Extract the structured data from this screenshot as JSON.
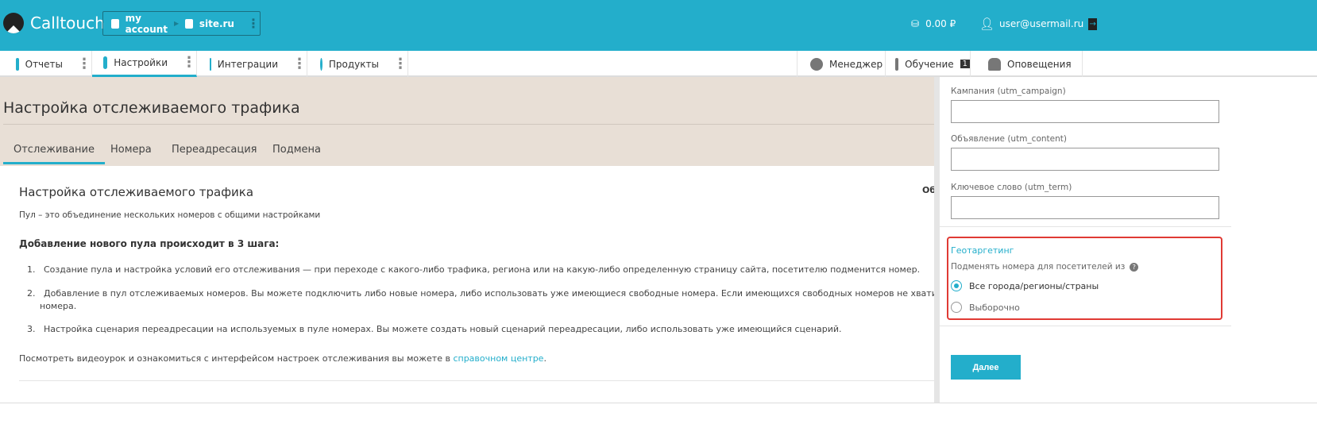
{
  "header": {
    "brand": "Calltouch",
    "account": "my account",
    "site": "site.ru",
    "balance": "0.00 ₽",
    "user": "user@usermail.ru"
  },
  "nav": {
    "left": [
      {
        "label": "Отчеты"
      },
      {
        "label": "Настройки",
        "active": true
      },
      {
        "label": "Интеграции"
      },
      {
        "label": "Продукты"
      }
    ],
    "right": [
      {
        "label": "Менеджер"
      },
      {
        "label": "Обучение",
        "badge": "1"
      },
      {
        "label": "Оповещения"
      }
    ]
  },
  "page": {
    "title": "Настройка отслеживаемого трафика",
    "tabs": [
      "Отслеживание",
      "Номера",
      "Переадресация",
      "Подмена"
    ],
    "active_tab": "Отслеживание"
  },
  "content": {
    "heading": "Настройка отслеживаемого трафика",
    "side_label": "Общ",
    "intro": "Пул – это объединение нескольких номеров с общими настройками",
    "steps_title": "Добавление нового пула происходит в 3 шага:",
    "steps": [
      "Создание пула и настройка условий его отслеживания — при переходе с какого-либо трафика, региона или на какую-либо определенную страницу сайта, посетителю подменится номер.",
      "Добавление в пул отслеживаемых номеров. Вы можете подключить либо новые номера, либо использовать уже имеющиеся свободные номера. Если имеющихся свободных номеров не хватит, можно",
      "номера.",
      "Настройка сценария переадресации на используемых в пуле номерах. Вы можете создать новый сценарий переадресации, либо использовать уже имеющийся сценарий."
    ],
    "footer_text": "Посмотреть видеоурок и ознакомиться с интерфейсом настроек отслеживания вы можете в ",
    "footer_link": "справочном центре",
    "footer_end": "."
  },
  "panel": {
    "fields": [
      {
        "label": "Кампания (utm_campaign)",
        "value": ""
      },
      {
        "label": "Объявление (utm_content)",
        "value": ""
      },
      {
        "label": "Ключевое слово (utm_term)",
        "value": ""
      }
    ],
    "geo": {
      "title": "Геотаргетинг",
      "subtitle": "Подменять номера для посетителей из",
      "options": [
        {
          "label": "Все города/регионы/страны",
          "selected": true
        },
        {
          "label": "Выборочно",
          "selected": false
        }
      ]
    },
    "next_button": "Далее"
  },
  "colors": {
    "brand": "#23aecb",
    "highlight": "#e03a34",
    "beige": "#e8dfd6"
  }
}
